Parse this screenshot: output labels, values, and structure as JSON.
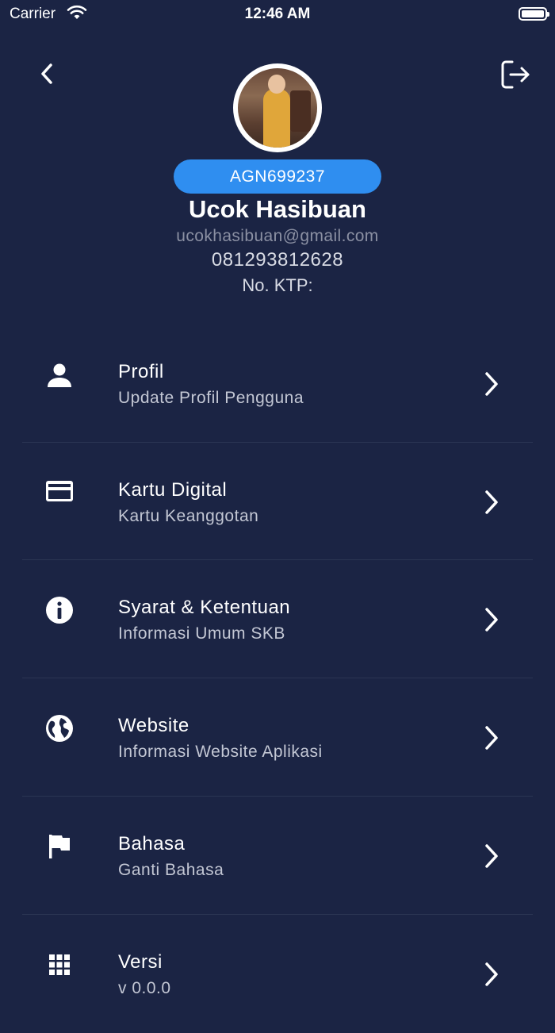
{
  "status_bar": {
    "carrier": "Carrier",
    "time": "12:46 AM"
  },
  "header": {
    "back_icon": "chevron-left-icon",
    "logout_icon": "logout-icon"
  },
  "profile": {
    "member_id": "AGN699237",
    "name": "Ucok Hasibuan",
    "email": "ucokhasibuan@gmail.com",
    "phone": "081293812628",
    "ktp_label": "No. KTP:"
  },
  "menu": {
    "items": [
      {
        "title": "Profil",
        "subtitle": "Update Profil Pengguna",
        "icon": "person-icon"
      },
      {
        "title": "Kartu Digital",
        "subtitle": "Kartu Keanggotan",
        "icon": "credit-card-icon"
      },
      {
        "title": "Syarat & Ketentuan",
        "subtitle": "Informasi Umum SKB",
        "icon": "info-icon"
      },
      {
        "title": "Website",
        "subtitle": "Informasi Website Aplikasi",
        "icon": "globe-icon"
      },
      {
        "title": "Bahasa",
        "subtitle": "Ganti Bahasa",
        "icon": "flag-icon"
      },
      {
        "title": "Versi",
        "subtitle": "v 0.0.0",
        "icon": "grid-icon"
      }
    ]
  },
  "colors": {
    "background": "#1b2444",
    "accent": "#2f8ef0",
    "muted_text": "#8b90a3"
  }
}
